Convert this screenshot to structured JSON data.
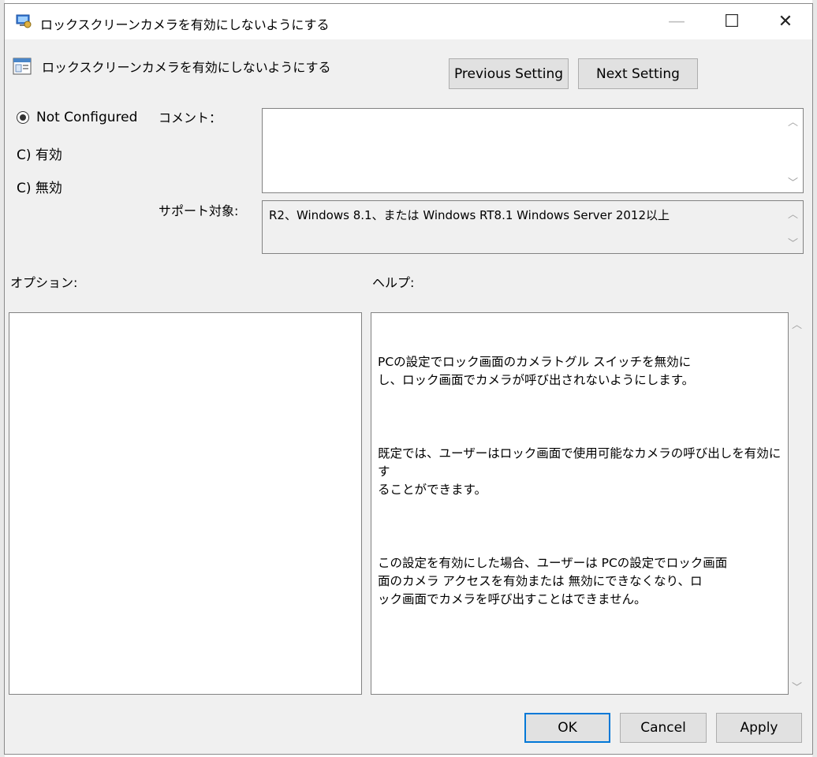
{
  "window": {
    "title": "ロックスクリーンカメラを有効にしないようにする",
    "controls": {
      "minimize": "—",
      "maximize": "☐",
      "close": "✕"
    }
  },
  "header": {
    "setting_name": "ロックスクリーンカメラを有効にしないようにする",
    "previous_label": "Previous Setting",
    "next_label": "Next Setting"
  },
  "state": {
    "options": [
      {
        "label": "Not Configured",
        "checked": true
      },
      {
        "label": "C) 有効",
        "checked": false
      },
      {
        "label": "C) 無効",
        "checked": false
      }
    ]
  },
  "comment": {
    "label": "コメント：",
    "value": ""
  },
  "supported": {
    "label": "サポート対象:",
    "value": "R2、Windows 8.1、または Windows RT8.1 Windows Server 2012以上"
  },
  "options_panel": {
    "label": "オプション:"
  },
  "help_panel": {
    "label": "ヘルプ:",
    "paragraphs": [
      "PCの設定でロック画面のカメラトグル スイッチを無効に\nし、ロック画面でカメラが呼び出されないようにします。",
      "既定では、ユーザーはロック画面で使用可能なカメラの呼び出しを有効にす\nることができます。",
      "この設定を有効にした場合、ユーザーは PCの設定でロック画面\n面のカメラ アクセスを有効または 無効にできなくなり、ロ\nック画面でカメラを呼び出すことはできません。"
    ]
  },
  "footer": {
    "ok_label": "OK",
    "cancel_label": "Cancel",
    "apply_label": "Apply"
  },
  "colors": {
    "focus_border": "#0078d7",
    "dialog_bg": "#f0f0f0"
  }
}
